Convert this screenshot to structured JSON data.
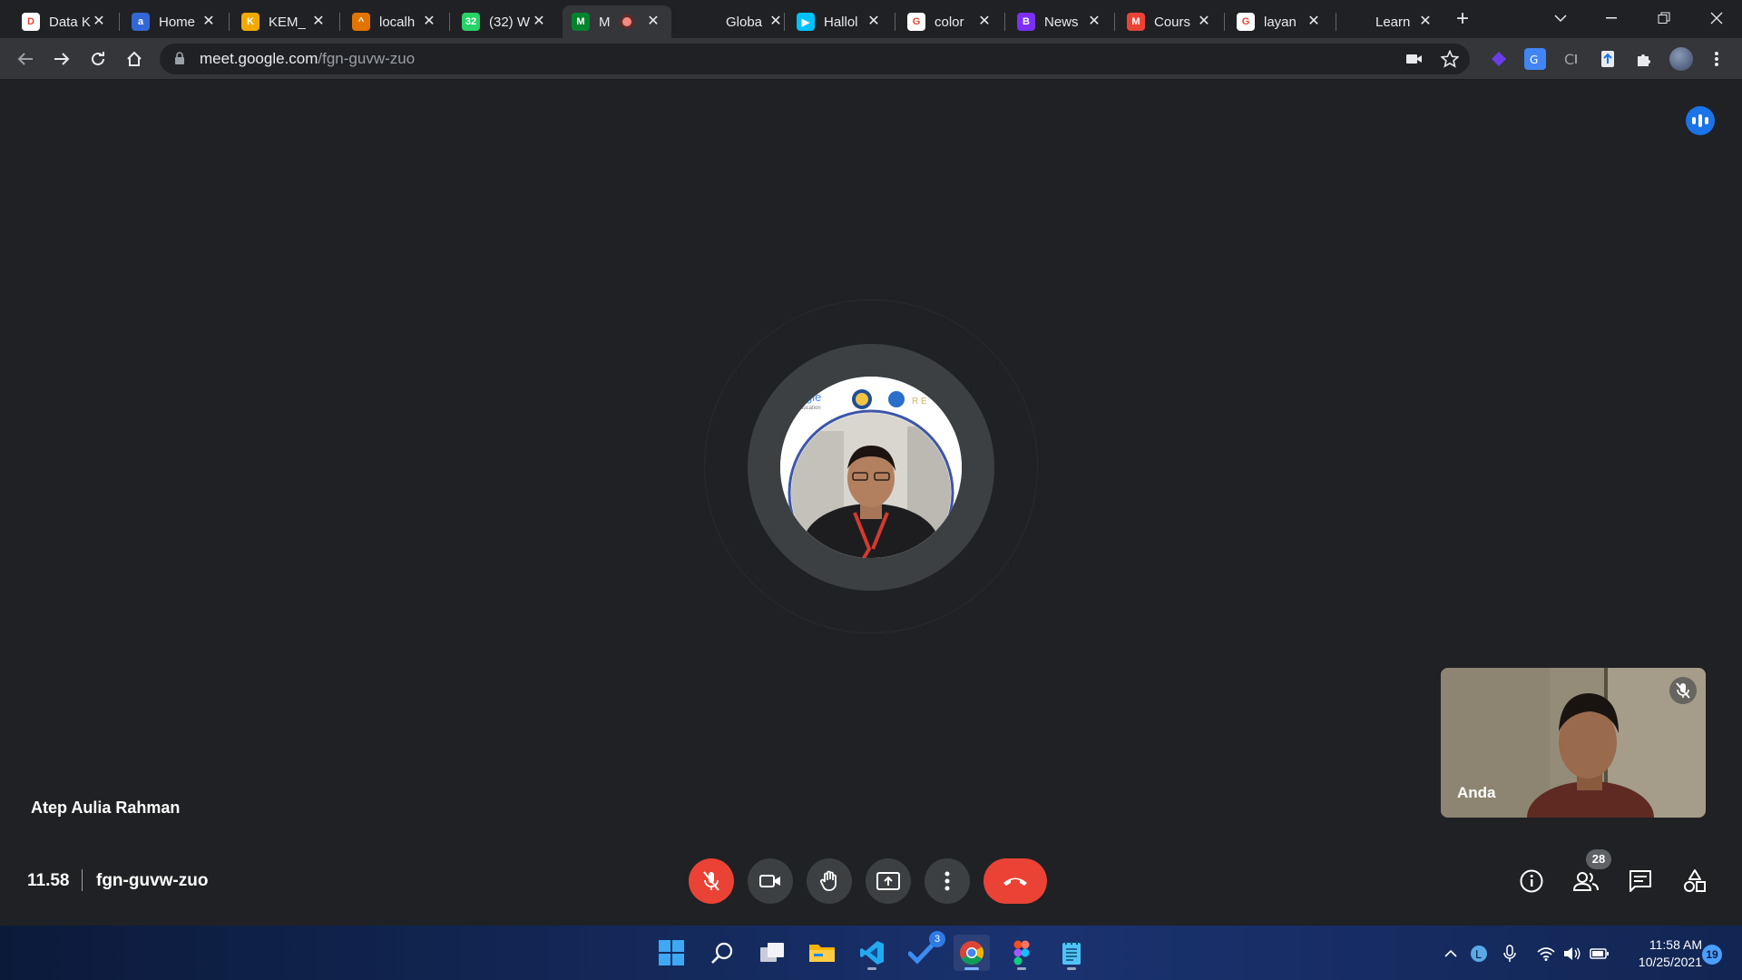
{
  "browser": {
    "tabs": [
      {
        "title": "Data K",
        "favicon": "data-favicon",
        "color": "#ffffff",
        "glyph": "D"
      },
      {
        "title": "Home",
        "favicon": "home-favicon",
        "color": "#3367d6",
        "glyph": "a"
      },
      {
        "title": "KEM_",
        "favicon": "kem-favicon",
        "color": "#f2a900",
        "glyph": "K"
      },
      {
        "title": "localh",
        "favicon": "localhost-favicon",
        "color": "#e37400",
        "glyph": "^"
      },
      {
        "title": "(32) W",
        "favicon": "whatsapp-favicon",
        "color": "#25d366",
        "glyph": "32"
      },
      {
        "title": "M",
        "favicon": "google-meet-favicon",
        "color": "#00832d",
        "glyph": "M"
      },
      {
        "title": "Globa",
        "favicon": "global-favicon",
        "color": "#202124",
        "glyph": ""
      },
      {
        "title": "Hallol",
        "favicon": "play-favicon",
        "color": "#00c2ff",
        "glyph": "▶"
      },
      {
        "title": "color",
        "favicon": "google-favicon",
        "color": "#ffffff",
        "glyph": "G"
      },
      {
        "title": "News",
        "favicon": "news-favicon",
        "color": "#7b2ff7",
        "glyph": "B"
      },
      {
        "title": "Cours",
        "favicon": "gmail-favicon",
        "color": "#ea4335",
        "glyph": "M"
      },
      {
        "title": "layan",
        "favicon": "google-favicon",
        "color": "#ffffff",
        "glyph": "G"
      },
      {
        "title": "Learn",
        "favicon": "learn-favicon",
        "color": "#202124",
        "glyph": ""
      }
    ],
    "close_glyph": "✕",
    "new_tab_glyph": "+",
    "url_host": "meet.google.com",
    "url_path": "/fgn-guvw-zuo"
  },
  "meet": {
    "presenter_name": "Atep Aulia Rahman",
    "self_label": "Anda",
    "meeting_time": "11.58",
    "meeting_code": "fgn-guvw-zuo",
    "participant_count": "28",
    "avatar_logo_text": "gle",
    "avatar_logo_sub": "ducation",
    "avatar_logo_right": "R E"
  },
  "taskbar": {
    "time": "11:58 AM",
    "date": "10/25/2021",
    "notifications": "19",
    "todo_badge": "3"
  },
  "colors": {
    "accent": "#1a73e8",
    "danger": "#ea4335",
    "stage": "#202124",
    "control": "#3c4043"
  }
}
